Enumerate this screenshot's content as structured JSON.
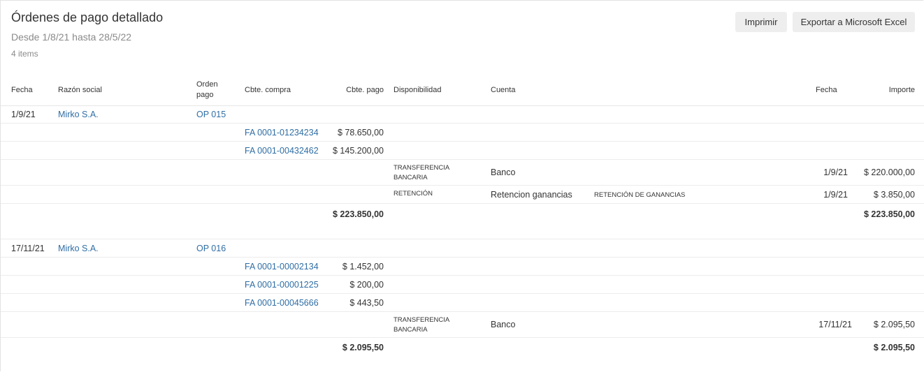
{
  "header": {
    "title": "Órdenes de pago detallado",
    "subtitle": "Desde 1/8/21 hasta 28/5/22",
    "count": "4 items"
  },
  "actions": {
    "print": "Imprimir",
    "export": "Exportar a Microsoft Excel"
  },
  "columns": {
    "fecha": "Fecha",
    "razon": "Razón social",
    "orden_1": "Orden",
    "orden_2": "pago",
    "cbte_compra": "Cbte. compra",
    "cbte_pago": "Cbte. pago",
    "disponibilidad": "Disponibilidad",
    "cuenta": "Cuenta",
    "fecha2": "Fecha",
    "importe": "Importe"
  },
  "orders": [
    {
      "fecha": "1/9/21",
      "razon": "Mirko S.A.",
      "orden": "OP 015",
      "comprobantes": [
        {
          "numero": "FA 0001-01234234",
          "importe": "$ 78.650,00"
        },
        {
          "numero": "FA 0001-00432462",
          "importe": "$ 145.200,00"
        }
      ],
      "pagos": [
        {
          "disp_1": "TRANSFERENCIA",
          "disp_2": "BANCARIA",
          "cuenta": "Banco",
          "detalle": "",
          "fecha": "1/9/21",
          "importe": "$ 220.000,00"
        },
        {
          "disp_1": "RETENCIÓN",
          "disp_2": "",
          "cuenta": "Retencion ganancias",
          "detalle": "RETENCIÓN DE GANANCIAS",
          "fecha": "1/9/21",
          "importe": "$ 3.850,00"
        }
      ],
      "total_compra": "$ 223.850,00",
      "total_pago": "$ 223.850,00"
    },
    {
      "fecha": "17/11/21",
      "razon": "Mirko S.A.",
      "orden": "OP 016",
      "comprobantes": [
        {
          "numero": "FA 0001-00002134",
          "importe": "$ 1.452,00"
        },
        {
          "numero": "FA 0001-00001225",
          "importe": "$ 200,00"
        },
        {
          "numero": "FA 0001-00045666",
          "importe": "$ 443,50"
        }
      ],
      "pagos": [
        {
          "disp_1": "TRANSFERENCIA",
          "disp_2": "BANCARIA",
          "cuenta": "Banco",
          "detalle": "",
          "fecha": "17/11/21",
          "importe": "$ 2.095,50"
        }
      ],
      "total_compra": "$ 2.095,50",
      "total_pago": "$ 2.095,50"
    }
  ]
}
